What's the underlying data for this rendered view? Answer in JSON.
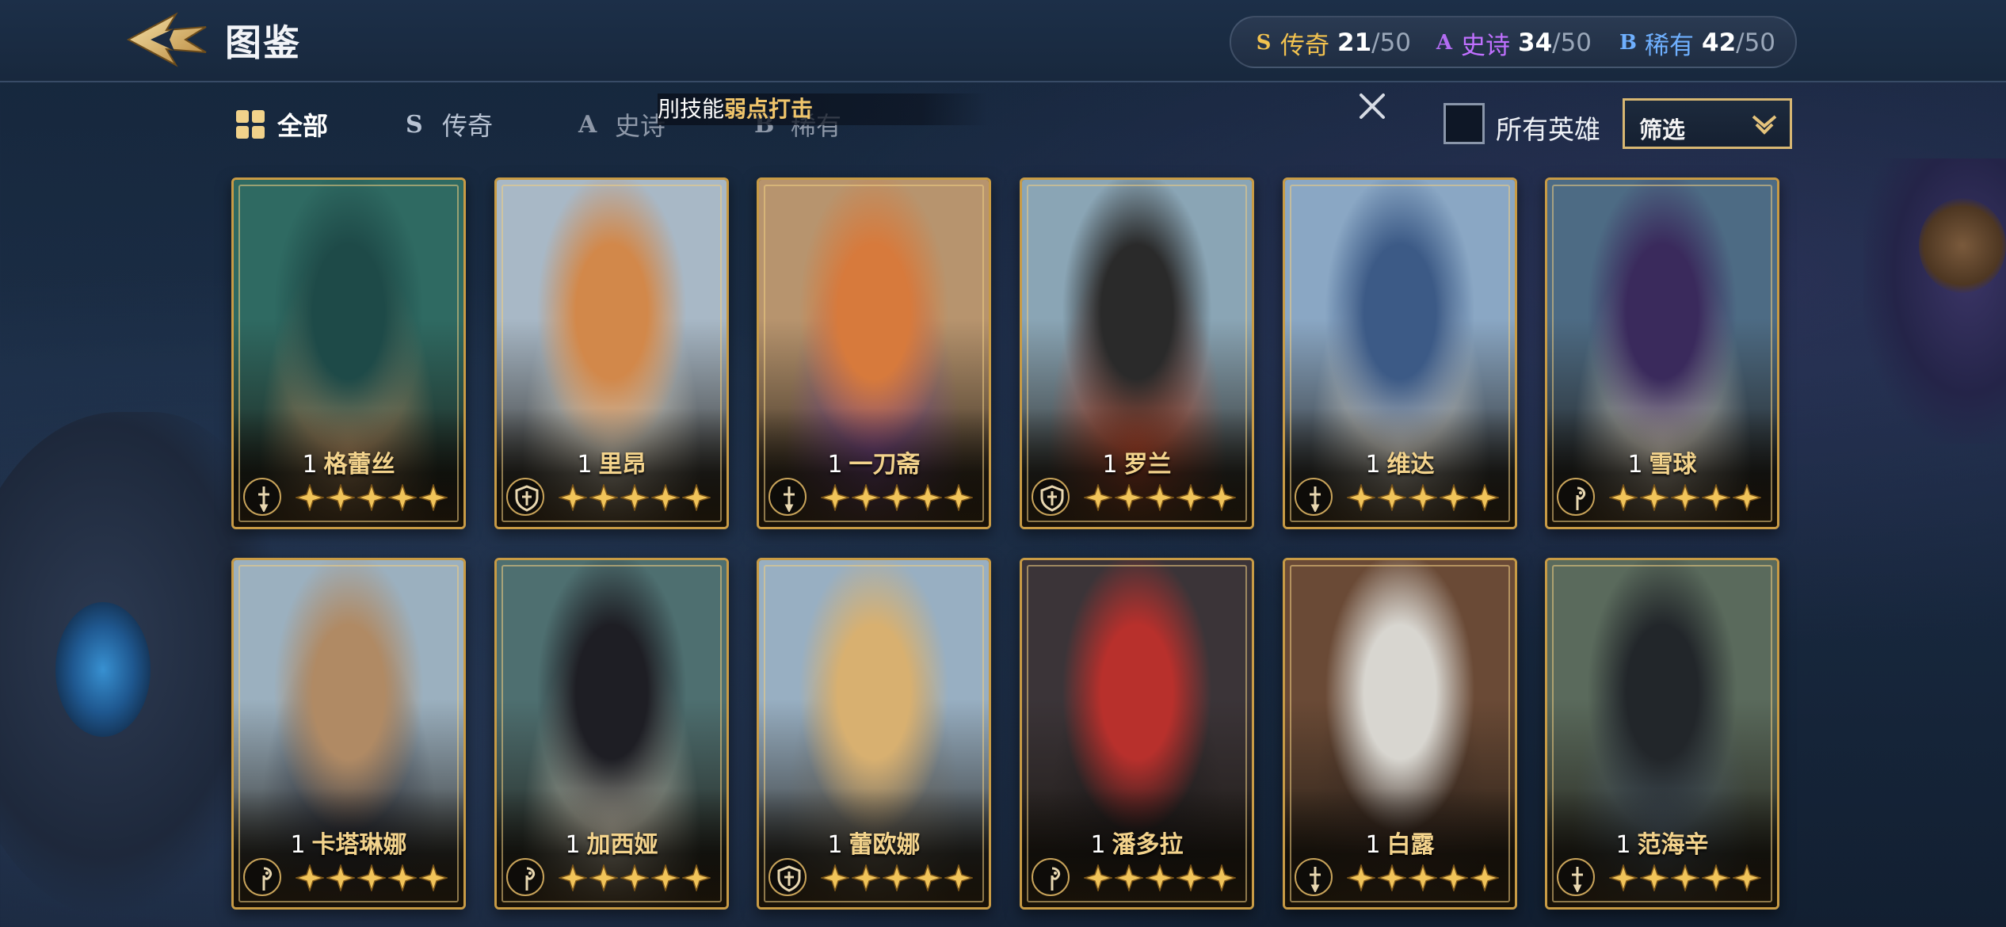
{
  "header": {
    "title": "图鉴",
    "rarities": [
      {
        "badge": "S",
        "name": "传奇",
        "count": "21",
        "total": "/50",
        "color": "#f2c24f",
        "badge_color": "#f2c24f"
      },
      {
        "badge": "A",
        "name": "史诗",
        "count": "34",
        "total": "/50",
        "color": "#c070ff",
        "badge_color": "#b36cf2"
      },
      {
        "badge": "B",
        "name": "稀有",
        "count": "42",
        "total": "/50",
        "color": "#6fb0ff",
        "badge_color": "#6fb0ff"
      }
    ]
  },
  "tabs": [
    {
      "label": "全部",
      "icon": "grid-icon",
      "active": true
    },
    {
      "label": "传奇",
      "icon": "s-rank-icon"
    },
    {
      "label": "史诗",
      "icon": "a-rank-icon"
    },
    {
      "label": "稀有",
      "icon": "b-rank-icon"
    }
  ],
  "tooltip": {
    "prefix": "刖技能",
    "highlight": "弱点打击"
  },
  "filter": {
    "all_heroes_label": "所有英雄",
    "filter_label": "筛选",
    "all_heroes_checked": false
  },
  "cards": [
    {
      "level": "1",
      "name": "格蕾丝",
      "role": "sword-role-icon",
      "stars": 5,
      "palette": [
        "#2f6a62",
        "#1e4a48",
        "#c59a6a"
      ]
    },
    {
      "level": "1",
      "name": "里昂",
      "role": "shield-role-icon",
      "stars": 5,
      "palette": [
        "#a8b8c6",
        "#d2884a",
        "#e6dfcf"
      ]
    },
    {
      "level": "1",
      "name": "一刀斋",
      "role": "sword-role-icon",
      "stars": 5,
      "palette": [
        "#b7946e",
        "#d77a3c",
        "#7c4a8e"
      ]
    },
    {
      "level": "1",
      "name": "罗兰",
      "role": "shield-role-icon",
      "stars": 5,
      "palette": [
        "#8aa5b5",
        "#2a2a2a",
        "#c84a2c"
      ]
    },
    {
      "level": "1",
      "name": "维达",
      "role": "sword-role-icon",
      "stars": 5,
      "palette": [
        "#8aa7c4",
        "#3c5a86",
        "#e8e4da"
      ]
    },
    {
      "level": "1",
      "name": "雪球",
      "role": "staff-role-icon",
      "stars": 5,
      "palette": [
        "#4d6b84",
        "#3a2a5c",
        "#e4dccd"
      ]
    },
    {
      "level": "1",
      "name": "卡塔琳娜",
      "role": "staff-role-icon",
      "stars": 5,
      "palette": [
        "#9bb0bf",
        "#b08a64",
        "#2a2e3a"
      ]
    },
    {
      "level": "1",
      "name": "加西娅",
      "role": "staff-role-icon",
      "stars": 5,
      "palette": [
        "#4e6f70",
        "#1e1e24",
        "#d8d2c0"
      ]
    },
    {
      "level": "1",
      "name": "蕾欧娜",
      "role": "shield-role-icon",
      "stars": 5,
      "palette": [
        "#98afc2",
        "#d8b070",
        "#6f6a60"
      ]
    },
    {
      "level": "1",
      "name": "潘多拉",
      "role": "staff-role-icon",
      "stars": 5,
      "palette": [
        "#3b3438",
        "#b8302c",
        "#1e1a1c"
      ]
    },
    {
      "level": "1",
      "name": "白露",
      "role": "sword-role-icon",
      "stars": 5,
      "palette": [
        "#6a4a36",
        "#d8d6d0",
        "#3a2a22"
      ]
    },
    {
      "level": "1",
      "name": "范海辛",
      "role": "sword-role-icon",
      "stars": 5,
      "palette": [
        "#5a6a5c",
        "#22262a",
        "#4a5a68"
      ]
    }
  ]
}
